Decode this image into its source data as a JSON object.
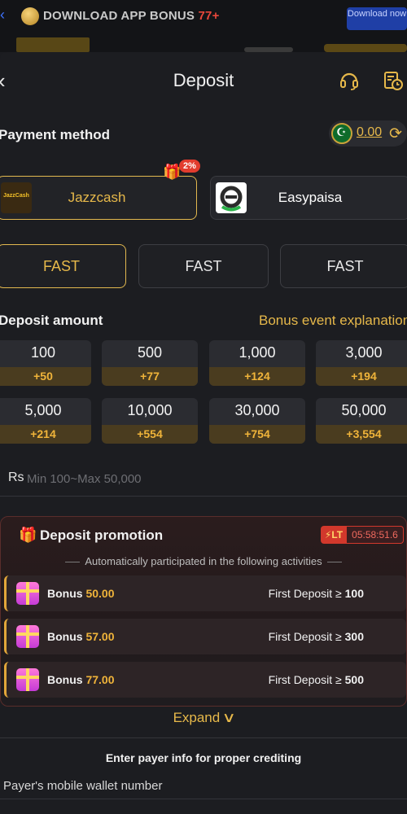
{
  "banner": {
    "text": "DOWNLOAD APP  BONUS",
    "bonus_num": "77+",
    "download_btn": "Download now"
  },
  "header": {
    "title": "Deposit"
  },
  "payment": {
    "label": "Payment method",
    "balance": "0.00",
    "methods": [
      {
        "label": "Jazzcash",
        "logo_text": "JazzCash",
        "active": true
      },
      {
        "label": "Easypaisa",
        "active": false
      }
    ],
    "badge": "2%"
  },
  "channels": [
    "FAST",
    "FAST",
    "FAST"
  ],
  "deposit": {
    "label": "Deposit amount",
    "bonus_link": "Bonus event explanation",
    "tiles": [
      {
        "amount": "100",
        "bonus": "+50"
      },
      {
        "amount": "500",
        "bonus": "+77"
      },
      {
        "amount": "1,000",
        "bonus": "+124"
      },
      {
        "amount": "3,000",
        "bonus": "+194"
      },
      {
        "amount": "5,000",
        "bonus": "+214"
      },
      {
        "amount": "10,000",
        "bonus": "+554"
      },
      {
        "amount": "30,000",
        "bonus": "+754"
      },
      {
        "amount": "50,000",
        "bonus": "+3,554"
      }
    ],
    "currency": "Rs",
    "placeholder": "Min 100~Max 50,000"
  },
  "promotion": {
    "title": "Deposit promotion",
    "lt_label": "LT",
    "timer": "05:58:51.6",
    "subtitle": "Automatically participated in the following activities",
    "items": [
      {
        "bonus_word": "Bonus",
        "bonus_value": "50.00",
        "cond_text": "First Deposit ≥",
        "cond_value": "100"
      },
      {
        "bonus_word": "Bonus",
        "bonus_value": "57.00",
        "cond_text": "First Deposit ≥",
        "cond_value": "300"
      },
      {
        "bonus_word": "Bonus",
        "bonus_value": "77.00",
        "cond_text": "First Deposit ≥",
        "cond_value": "500"
      }
    ],
    "expand": "Expand"
  },
  "payer": {
    "title": "Enter payer info for proper crediting",
    "placeholder": "Payer's mobile wallet number"
  },
  "colors": {
    "accent": "#e6b84a",
    "bonus_bar": "#4a3c1f",
    "alert": "#d2382c",
    "background": "#1c1d21"
  }
}
